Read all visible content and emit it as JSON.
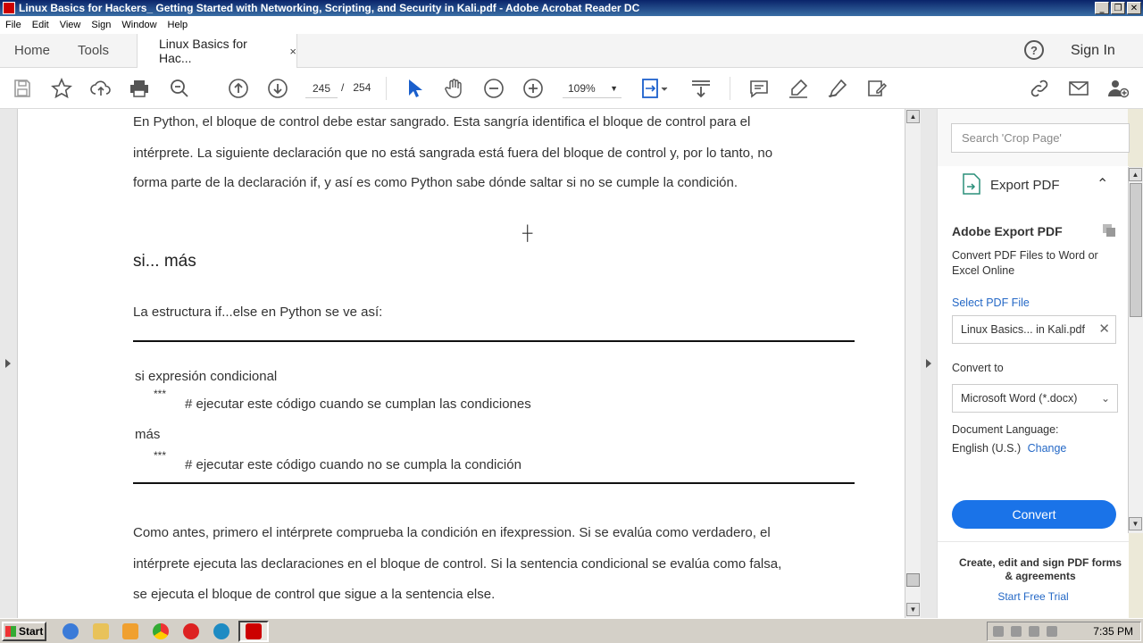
{
  "window": {
    "title": "Linux Basics for Hackers_ Getting Started with Networking, Scripting, and Security in Kali.pdf - Adobe Acrobat Reader DC",
    "controls": [
      "_",
      "❐",
      "✕"
    ]
  },
  "menu": [
    "File",
    "Edit",
    "View",
    "Sign",
    "Window",
    "Help"
  ],
  "tabs": {
    "home": "Home",
    "tools": "Tools",
    "document": "Linux Basics for Hac...",
    "close": "×",
    "help": "?",
    "signin": "Sign In"
  },
  "toolbar": {
    "page_current": "245",
    "page_sep": "/",
    "page_total": "254",
    "zoom": "109%",
    "icons": [
      "save-icon",
      "bookmark-star-icon",
      "upload-icon",
      "print-icon",
      "zoom-search-icon",
      "page-up-icon",
      "page-down-icon",
      "select-cursor-icon",
      "hand-icon",
      "zoom-out-icon",
      "zoom-in-icon",
      "fit-page-icon",
      "scroll-mode-icon",
      "comment-icon",
      "highlight-icon",
      "sign-icon",
      "fill-sign-icon",
      "share-link-icon",
      "email-icon",
      "add-user-icon"
    ]
  },
  "document": {
    "para1": [
      "En Python, el bloque de control debe estar sangrado. Esta sangría identifica el bloque de control para el",
      "intérprete. La siguiente declaración que no está sangrada está fuera del bloque de control y, por lo tanto, no",
      "forma parte de la declaración if, y así es como Python sabe dónde saltar si no se cumple la condición."
    ],
    "heading": "si... más",
    "intro": "La estructura if...else en Python se ve así:",
    "code": {
      "line1": "si expresión condicional",
      "stars1": "***",
      "comment1": "# ejecutar este código cuando se cumplan las condiciones",
      "line2": "más",
      "stars2": "***",
      "comment2": "# ejecutar este código cuando no se cumpla la condición"
    },
    "para2": [
      "Como antes, primero el intérprete comprueba la condición en ifexpression. Si se evalúa como verdadero, el",
      "intérprete ejecuta las declaraciones en el bloque de control. Si la sentencia condicional se evalúa como falsa,",
      "se ejecuta el bloque de control que sigue a la sentencia else."
    ]
  },
  "panel": {
    "search_placeholder": "Search 'Crop Page'",
    "export_title": "Export PDF",
    "adobe_export": "Adobe Export PDF",
    "description": "Convert PDF Files to Word or Excel Online",
    "select_file": "Select PDF File",
    "file_name": "Linux Basics... in Kali.pdf",
    "convert_to": "Convert to",
    "format": "Microsoft Word (*.docx)",
    "doc_language_label": "Document Language:",
    "language": "English (U.S.)",
    "change": "Change",
    "convert_btn": "Convert",
    "promo": "Create, edit and sign PDF forms & agreements",
    "trial": "Start Free Trial"
  },
  "taskbar": {
    "start": "Start",
    "clock": "7:35 PM"
  },
  "colors": {
    "accent": "#1a73e8",
    "link": "#2468c6",
    "titlebar": "#0a246a"
  }
}
